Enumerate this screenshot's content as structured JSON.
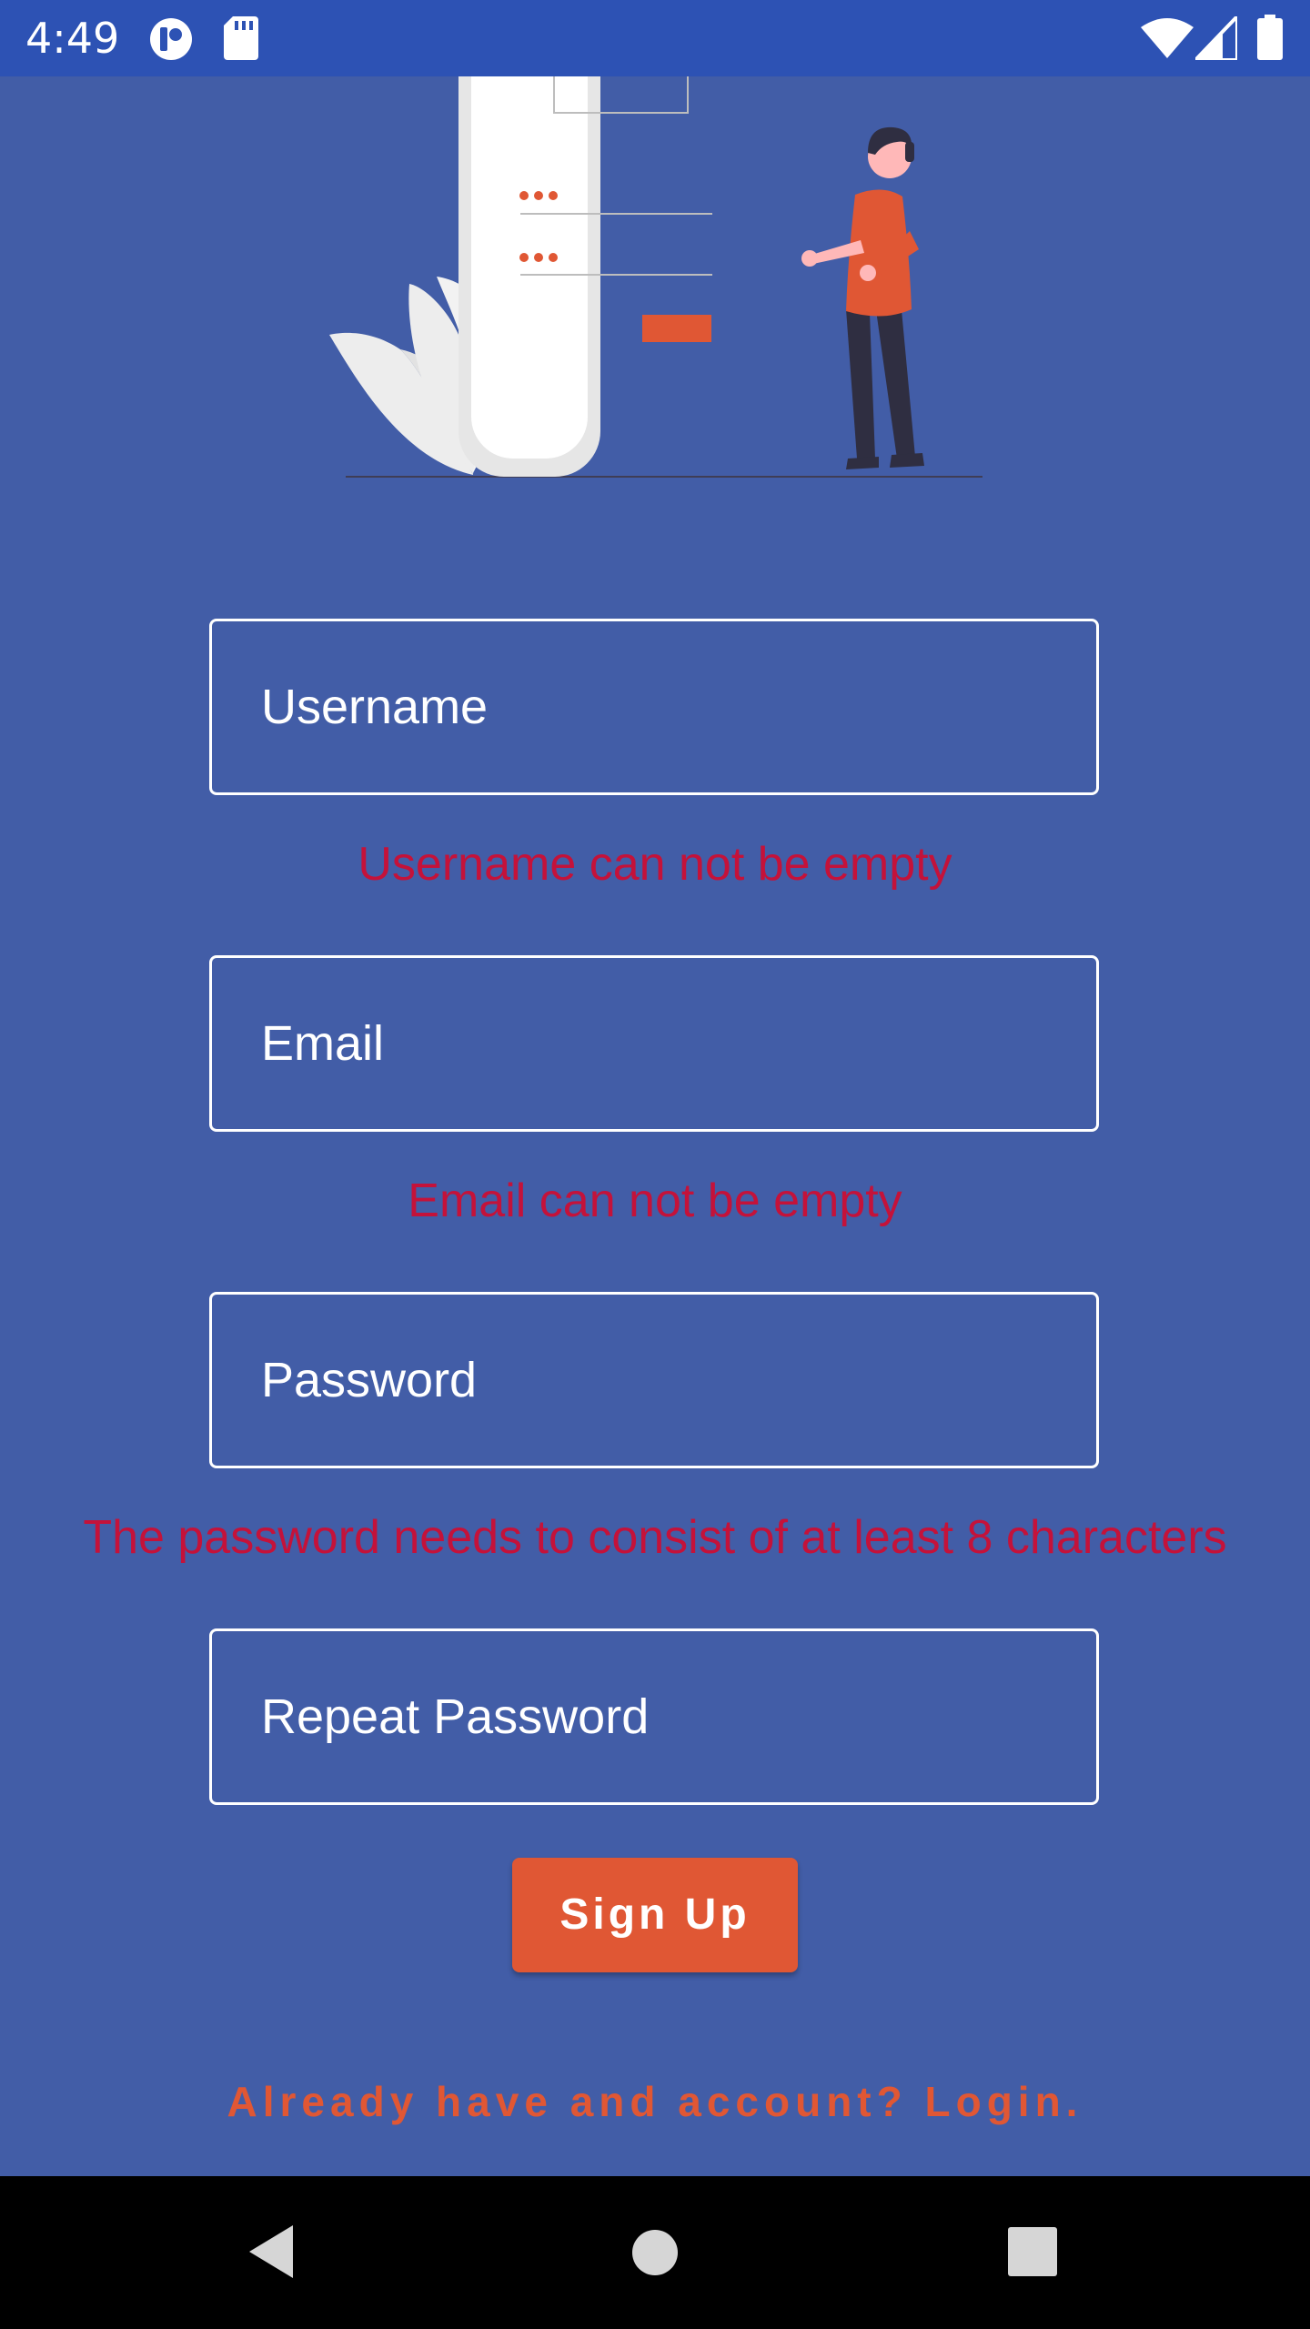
{
  "status_bar": {
    "time": "4:49",
    "icons": [
      "app-notification-icon",
      "sd-card-icon",
      "wifi-icon",
      "cell-signal-icon",
      "battery-icon"
    ]
  },
  "illustration": {
    "name": "person-with-phone-login-illustration"
  },
  "form": {
    "username": {
      "placeholder": "Username",
      "error": "Username can not be empty"
    },
    "email": {
      "placeholder": "Email",
      "error": "Email can not be empty"
    },
    "password": {
      "placeholder": "Password",
      "error": "The password needs to consist of at least 8 characters"
    },
    "repeat_password": {
      "placeholder": "Repeat Password"
    },
    "signup_label": "Sign Up",
    "login_link": "Already have and account? Login."
  },
  "nav_bar": {
    "icons": [
      "back-icon",
      "home-icon",
      "recents-icon"
    ]
  },
  "colors": {
    "background": "#425DA7",
    "status_bar": "#2D52B4",
    "accent": "#E05734",
    "error": "#C4123A",
    "field_border": "#FFFFFF"
  }
}
